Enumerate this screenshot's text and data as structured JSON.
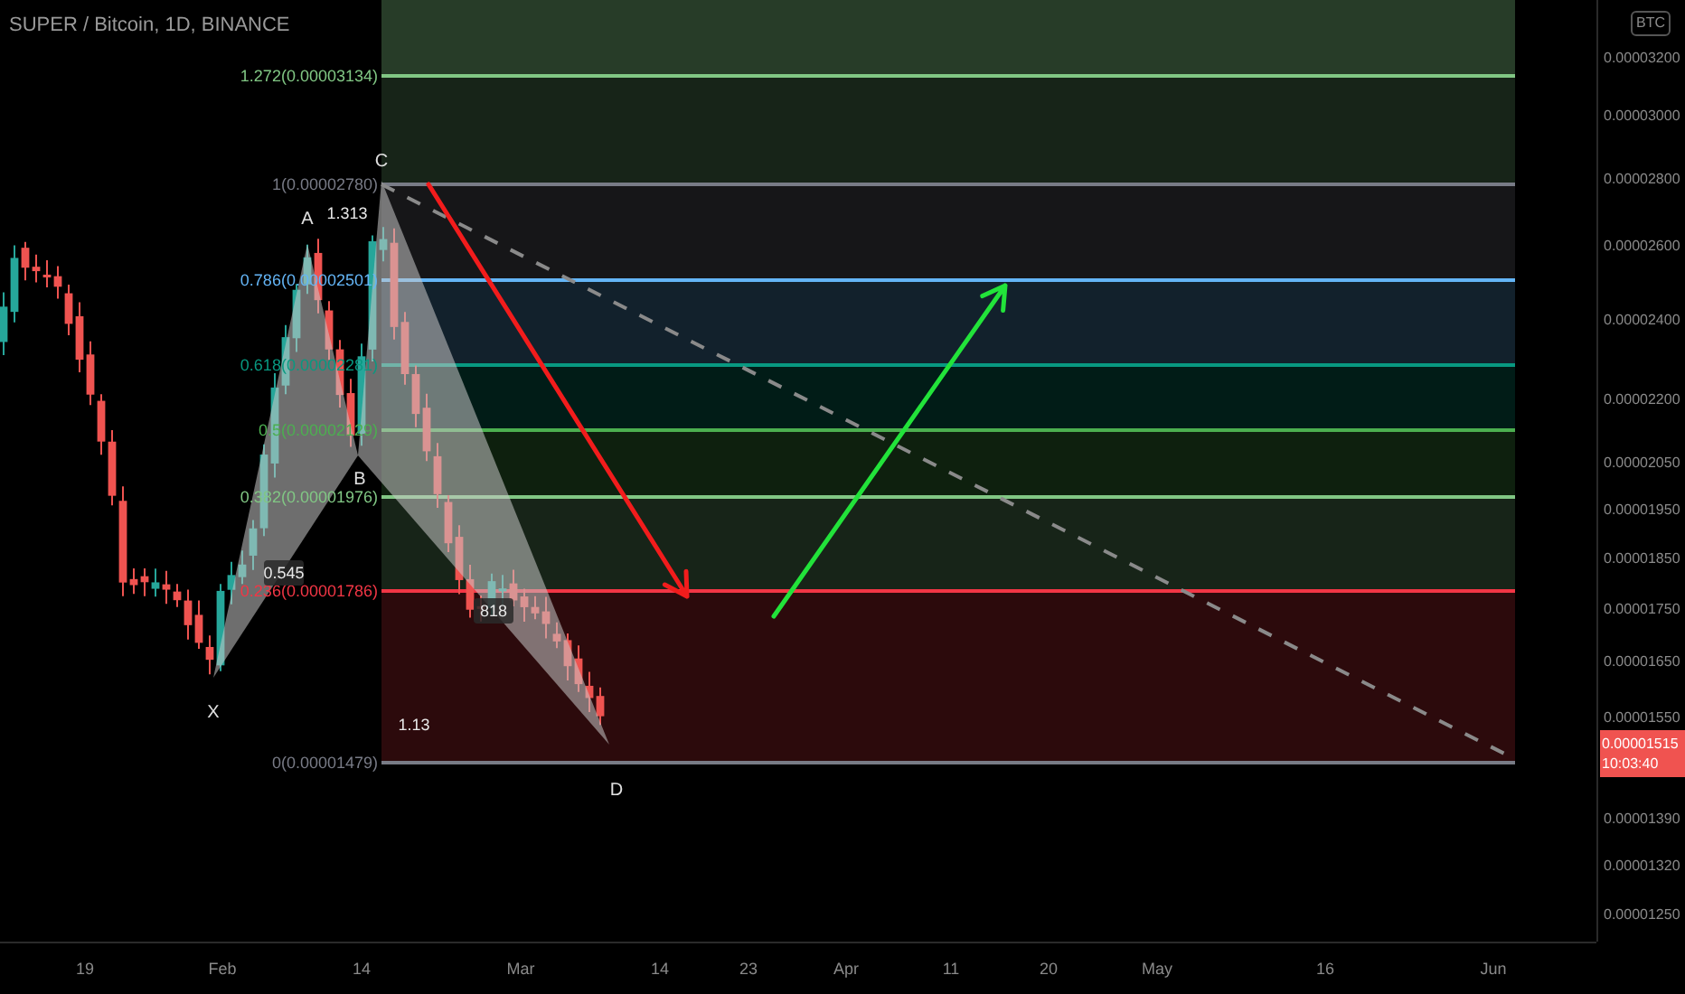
{
  "header": {
    "title": "SUPER / Bitcoin, 1D, BINANCE"
  },
  "fib_levels": [
    {
      "label": "1.272(0.00003134)",
      "color": "#81c784"
    },
    {
      "label": "1(0.00002780)",
      "color": "#787b86"
    },
    {
      "label": "0.786(0.00002501)",
      "color": "#64b5f6"
    },
    {
      "label": "0.618(0.00002281)",
      "color": "#089981"
    },
    {
      "label": "0.5(0.00002129)",
      "color": "#4caf50"
    },
    {
      "label": "0.382(0.00001976)",
      "color": "#81c784"
    },
    {
      "label": "0.236(0.00001786)",
      "color": "#f23645"
    },
    {
      "label": "0(0.00001479)",
      "color": "#787b86"
    }
  ],
  "pattern": {
    "points": [
      "X",
      "A",
      "B",
      "C",
      "D"
    ],
    "ratios": [
      "1.313",
      "0.545",
      "818",
      "1.13"
    ]
  },
  "price_axis": {
    "currency": "BTC",
    "labels": [
      "0.00003200",
      "0.00003000",
      "0.00002800",
      "0.00002600",
      "0.00002400",
      "0.00002200",
      "0.00002050",
      "0.00001950",
      "0.00001850",
      "0.00001750",
      "0.00001650",
      "0.00001550",
      "0.00001390",
      "0.00001320",
      "0.00001250"
    ],
    "last_price": "0.00001515",
    "countdown": "10:03:40"
  },
  "time_axis": {
    "labels": [
      "19",
      "Feb",
      "14",
      "Mar",
      "14",
      "23",
      "Apr",
      "11",
      "20",
      "May",
      "16",
      "Jun"
    ]
  }
}
